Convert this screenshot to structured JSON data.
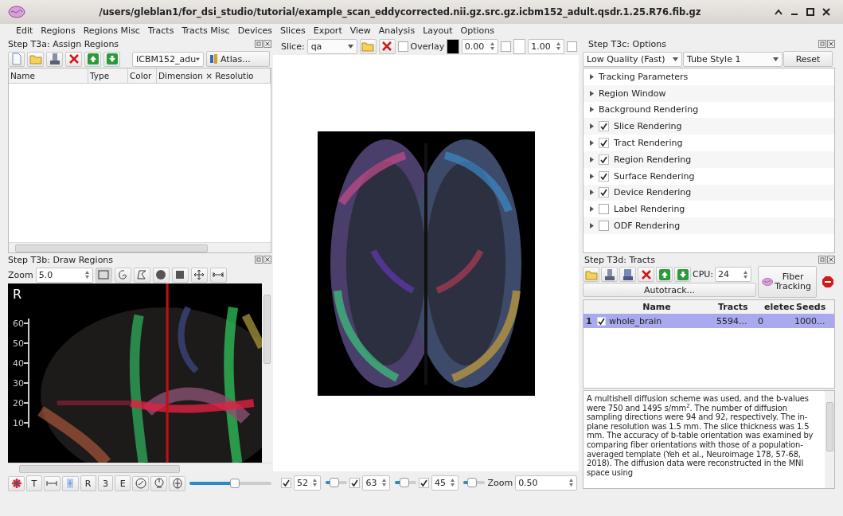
{
  "window": {
    "title": "/users/gleblan1/for_dsi_studio/tutorial/example_scan_eddycorrected.nii.gz.src.gz.icbm152_adult.qsdr.1.25.R76.fib.gz"
  },
  "menu": [
    "Edit",
    "Regions",
    "Regions Misc",
    "Tracts",
    "Tracts Misc",
    "Devices",
    "Slices",
    "Export",
    "View",
    "Analysis",
    "Layout",
    "Options"
  ],
  "assign_regions": {
    "title": "Step T3a: Assign Regions",
    "atlas_combo": "ICBM152_adu",
    "atlas_button": "Atlas...",
    "columns": [
      "Name",
      "Type",
      "Color",
      "Dimension × Resolutio"
    ]
  },
  "draw_regions": {
    "title": "Step T3b: Draw Regions",
    "zoom_label": "Zoom",
    "zoom_value": "5.0",
    "orientation_label": "R",
    "y_ticks": [
      "60",
      "50",
      "40",
      "30",
      "20",
      "10"
    ],
    "tool_buttons": [
      "T",
      "R",
      "3",
      "E"
    ],
    "slider": {
      "level": 0.55
    }
  },
  "slice_bar": {
    "slice_label": "Slice:",
    "slice_combo": "qa",
    "overlay": {
      "label": "Overlay",
      "checked": false
    },
    "min_value": "0.00",
    "min_check": false,
    "max_value": "1.00",
    "max_check": false
  },
  "position_bar": {
    "slices": [
      {
        "checked": true,
        "value": "52",
        "level": 0.4
      },
      {
        "checked": true,
        "value": "63",
        "level": 0.45
      },
      {
        "checked": true,
        "value": "45",
        "level": 0.4
      }
    ],
    "zoom_label": "Zoom",
    "zoom_value": "0.50"
  },
  "options": {
    "title": "Step T3c: Options",
    "quality": "Low Quality (Fast)",
    "style": "Tube Style 1",
    "reset": "Reset",
    "items": [
      {
        "label": "Tracking Parameters",
        "kind": "group"
      },
      {
        "label": "Region Window",
        "kind": "group"
      },
      {
        "label": "Background Rendering",
        "kind": "group"
      },
      {
        "label": "Slice Rendering",
        "kind": "toggle",
        "checked": true
      },
      {
        "label": "Tract Rendering",
        "kind": "toggle",
        "checked": true
      },
      {
        "label": "Region Rendering",
        "kind": "toggle",
        "checked": true
      },
      {
        "label": "Surface Rendering",
        "kind": "toggle",
        "checked": true
      },
      {
        "label": "Device Rendering",
        "kind": "toggle",
        "checked": true
      },
      {
        "label": "Label Rendering",
        "kind": "toggle",
        "checked": false
      },
      {
        "label": "ODF Rendering",
        "kind": "toggle",
        "checked": false
      }
    ]
  },
  "tracts": {
    "title": "Step T3d: Tracts",
    "cpu_label": "CPU:",
    "cpu_value": "24",
    "autotrack": "Autotrack...",
    "fiber_tracking": "Fiber Tracking",
    "columns": [
      "Name",
      "Tracts",
      "eletec",
      "Seeds"
    ],
    "rows": [
      {
        "index": "1",
        "checked": true,
        "name": "whole_brain",
        "tracts": "5594...",
        "deleted": "0",
        "seeds": "1000...",
        "selected": true
      }
    ]
  },
  "description": "A multishell diffusion scheme was used, and the b-values were 750 and 1495 s/mm$^{2}$. The number of diffusion sampling directions were 94 and 92, respectively. The in-plane resolution was 1.5 mm. The slice thickness was 1.5 mm. The accuracy of b-table orientation was examined by comparing fiber orientations with those of a population-averaged template (Yeh et al., Neuroimage 178, 57-68, 2018). The diffusion data were reconstructed in the MNI space using"
}
